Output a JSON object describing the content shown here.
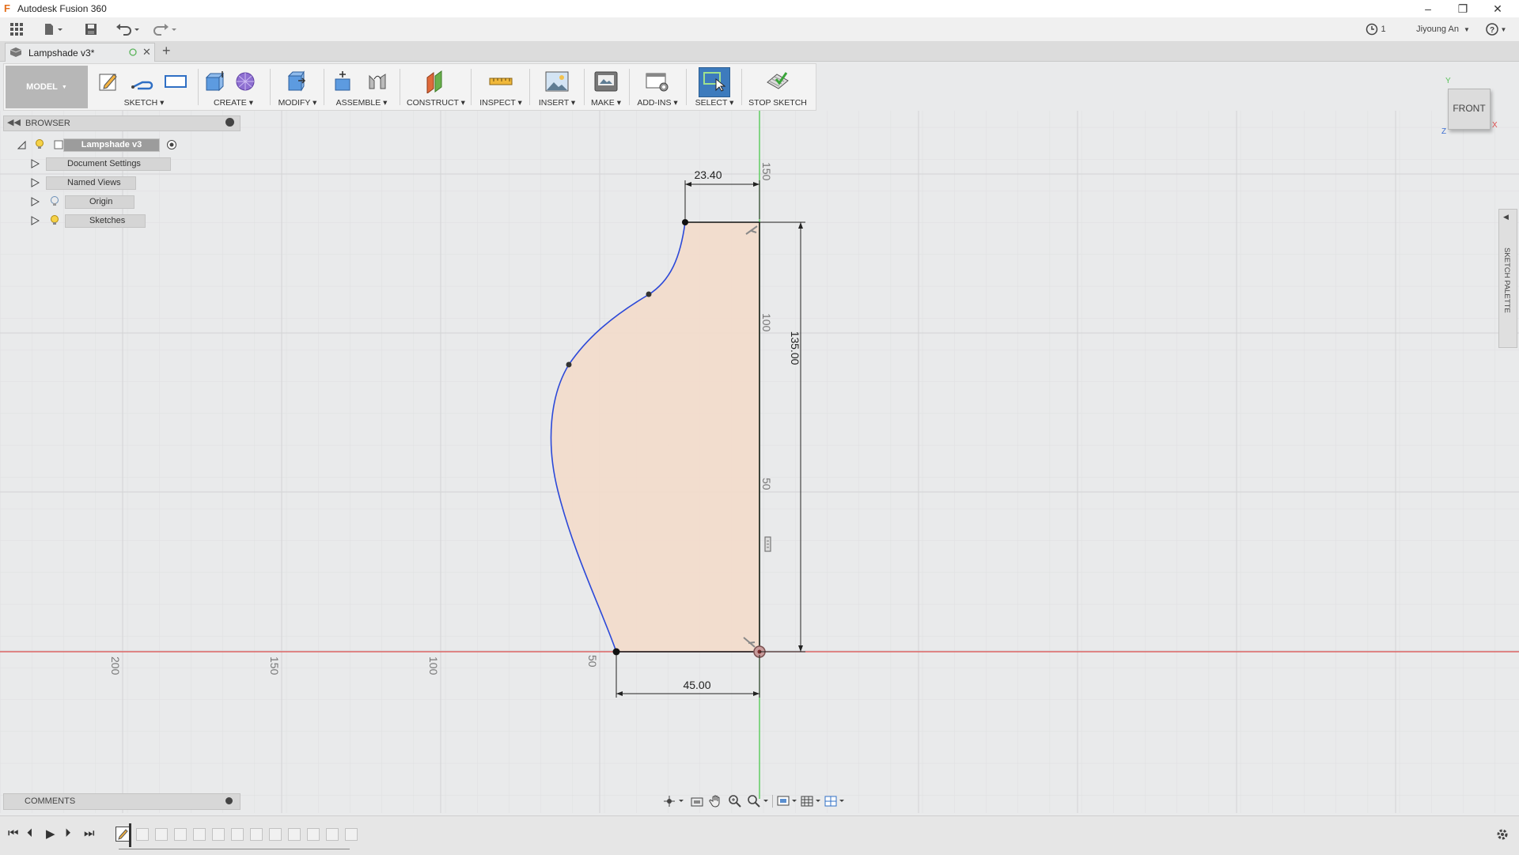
{
  "app": {
    "title": "Autodesk Fusion 360",
    "logo_letter": "F",
    "user": "Jiyoung An",
    "jobs_count": "1",
    "help": "?"
  },
  "document": {
    "tab_name": "Lampshade v3*"
  },
  "workspace": {
    "label": "MODEL"
  },
  "toolbar": {
    "sketch": "SKETCH",
    "create": "CREATE",
    "modify": "MODIFY",
    "assemble": "ASSEMBLE",
    "construct": "CONSTRUCT",
    "inspect": "INSPECT",
    "insert": "INSERT",
    "make": "MAKE",
    "addins": "ADD-INS",
    "select": "SELECT",
    "stop_sketch": "STOP SKETCH"
  },
  "browser": {
    "title": "BROWSER",
    "root": "Lampshade v3",
    "items": [
      {
        "label": "Document Settings",
        "icon": "gear-icon"
      },
      {
        "label": "Named Views",
        "icon": "folder-icon"
      },
      {
        "label": "Origin",
        "icon": "folder-icon"
      },
      {
        "label": "Sketches",
        "icon": "folder-icon"
      }
    ]
  },
  "comments": {
    "title": "COMMENTS"
  },
  "sketch_palette": {
    "label": "SKETCH PALETTE"
  },
  "viewcube": {
    "face": "FRONT",
    "axis_y": "Y",
    "axis_x": "X",
    "axis_z": "Z"
  },
  "canvas": {
    "dimension_top_width": "23.40",
    "dimension_height": "135.00",
    "dimension_bottom_width": "45.00",
    "ruler_vertical": [
      "150",
      "100",
      "50"
    ],
    "ruler_horizontal": [
      "200",
      "150",
      "100",
      "50"
    ]
  },
  "colors": {
    "x_axis": "#e0504f",
    "y_axis": "#4cc94c",
    "profile_fill": "#f3dccb",
    "spline": "#2c49d8",
    "select_active": "#3d7bbd"
  }
}
